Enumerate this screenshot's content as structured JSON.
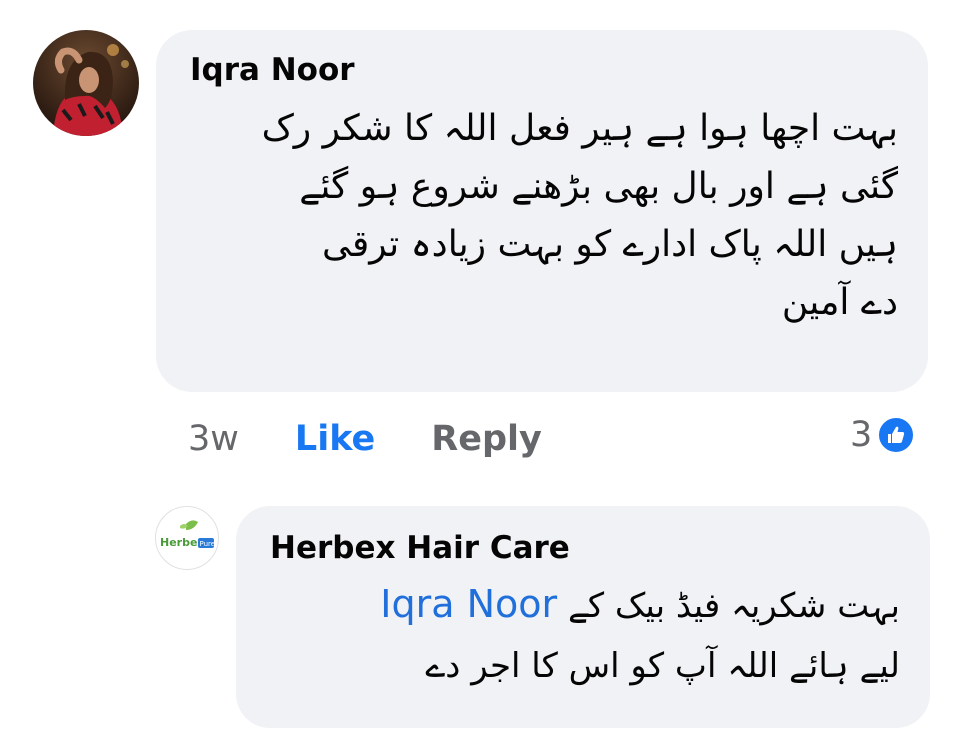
{
  "comment": {
    "author": "Iqra Noor",
    "text_lines": [
      "بہت اچھا ہوا ہے ہیر فعل اللہ کا شکر رک",
      "گئی ہے اور بال بھی بڑھنے شروع ہو گئے",
      "ہیں اللہ پاک ادارے کو بہت زیادہ ترقی",
      "دے آمین"
    ],
    "time": "3w",
    "like_label": "Like",
    "reply_label": "Reply",
    "reaction_count": "3",
    "reaction_icon": "thumbs-up-icon"
  },
  "reply": {
    "author": "Herbex Hair Care",
    "mention": "Iqra Noor",
    "line1_text": "بہت شکریہ فیڈ بیک کے",
    "line2_text": "لیے ہائے اللہ آپ کو اس کا اجر دے",
    "avatar_logo_text": "Herbex",
    "avatar_logo_badge": "Pure"
  },
  "colors": {
    "bubble": "#f0f2f5",
    "like_blue": "#1877f2",
    "mention_blue": "#216fdb",
    "muted": "#65676b"
  }
}
